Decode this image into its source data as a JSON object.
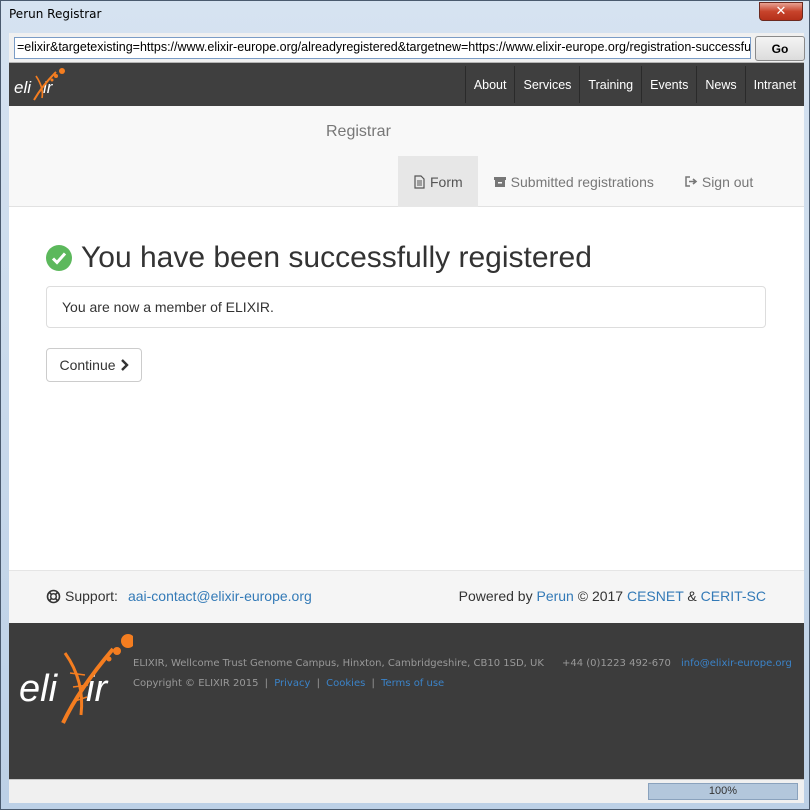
{
  "window": {
    "title": "Perun Registrar",
    "close_label": "✕"
  },
  "addressbar": {
    "url": "=elixir&targetexisting=https://www.elixir-europe.org/alreadyregistered&targetnew=https://www.elixir-europe.org/registration-successful",
    "go_label": "Go"
  },
  "topnav": {
    "logo_text": "elixir",
    "items": [
      "About",
      "Services",
      "Training",
      "Events",
      "News",
      "Intranet"
    ]
  },
  "subheader": {
    "brand": "Registrar",
    "tabs": [
      {
        "label": "Form",
        "icon": "document-icon",
        "active": true
      },
      {
        "label": "Submitted registrations",
        "icon": "archive-icon"
      },
      {
        "label": "Sign out",
        "icon": "sign-out-icon"
      }
    ]
  },
  "main": {
    "title": "You have been successfully registered",
    "message": "You are now a member of ELIXIR.",
    "continue_label": "Continue"
  },
  "support": {
    "label": "Support:",
    "email": "aai-contact@elixir-europe.org",
    "powered_by": "Powered by",
    "perun": "Perun",
    "copyright": "© 2017",
    "cesnet": "CESNET",
    "amp": "&",
    "cerit": "CERIT-SC"
  },
  "footer": {
    "logo_text": "elixir",
    "address": "ELIXIR, Wellcome Trust Genome Campus, Hinxton, Cambridgeshire, CB10 1SD, UK",
    "phone": "+44 (0)1223 492-670",
    "email": "info@elixir-europe.org",
    "copyright": "Copyright © ELIXIR 2015",
    "links": [
      "Privacy",
      "Cookies",
      "Terms of use"
    ]
  },
  "statusbar": {
    "progress": 1.0,
    "progress_label": "100%"
  },
  "colors": {
    "accent_orange": "#f47d20",
    "success_green": "#5cb85c",
    "link_blue": "#337ab7"
  }
}
